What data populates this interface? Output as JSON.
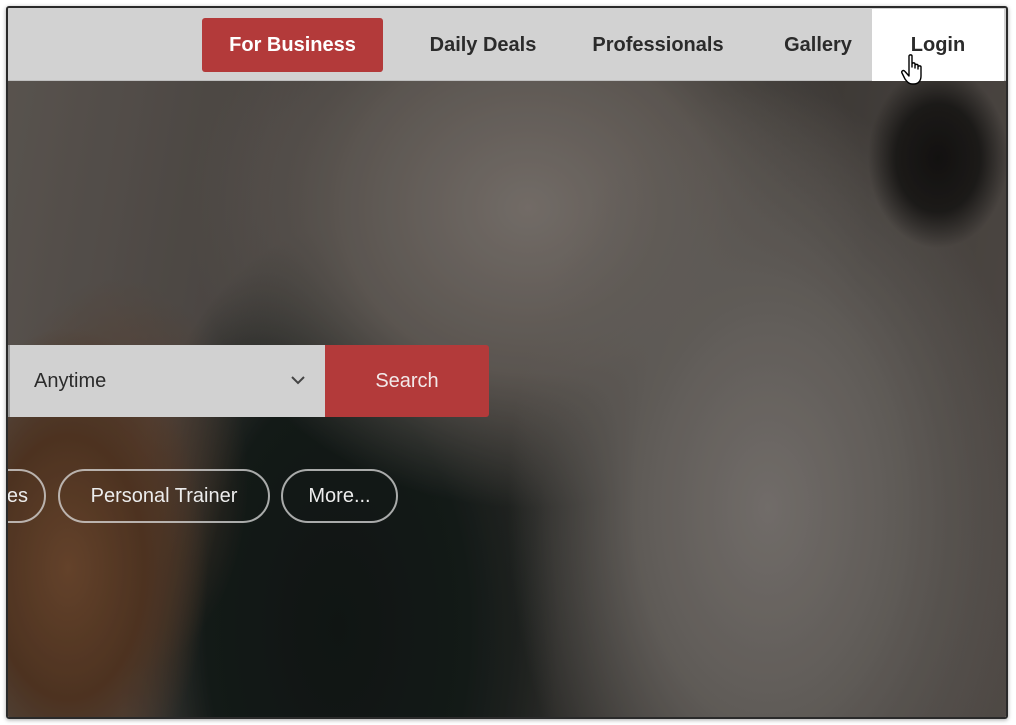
{
  "nav": {
    "for_business": "For Business",
    "daily_deals": "Daily Deals",
    "professionals": "Professionals",
    "gallery": "Gallery",
    "login": "Login"
  },
  "search": {
    "time_select_value": "Anytime",
    "search_button": "Search"
  },
  "categories": {
    "partial_pill": "es",
    "personal_trainer": "Personal Trainer",
    "more": "More..."
  },
  "colors": {
    "brand_red": "#b33a3a",
    "nav_bg": "#d2d2d2"
  },
  "icons": {
    "select_caret": "chevron-down-icon",
    "pointer": "hand-pointer-icon"
  }
}
